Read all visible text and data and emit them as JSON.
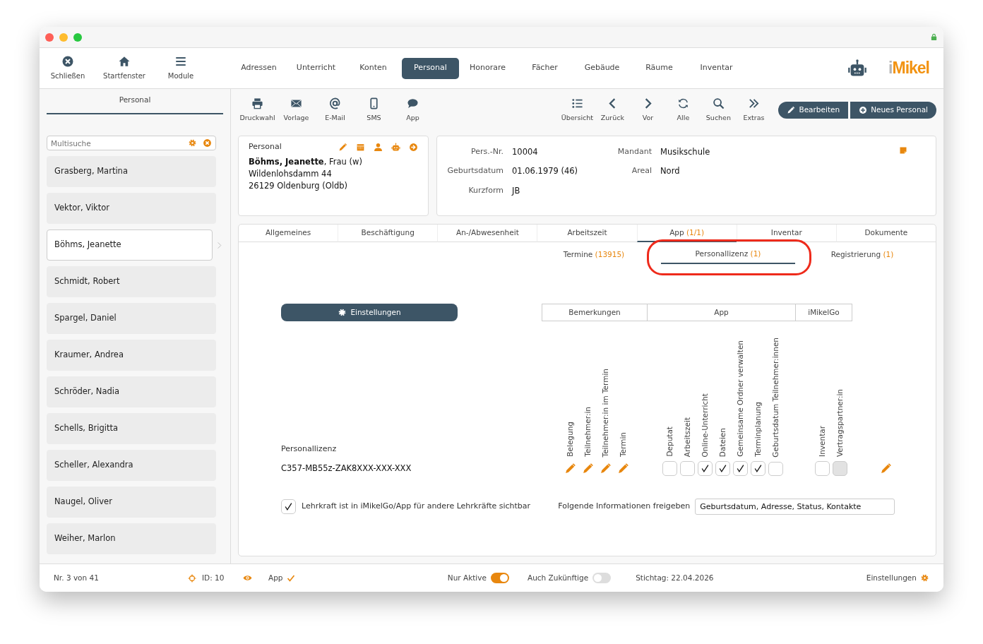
{
  "app_menu": [
    {
      "label": "Schließen"
    },
    {
      "label": "Startfenster"
    },
    {
      "label": "Module"
    }
  ],
  "modules": [
    {
      "label": "Adressen",
      "selected": false
    },
    {
      "label": "Unterricht",
      "selected": false
    },
    {
      "label": "Konten",
      "selected": false
    },
    {
      "label": "Personal",
      "selected": true
    },
    {
      "label": "Honorare",
      "selected": false
    },
    {
      "label": "Fächer",
      "selected": false
    },
    {
      "label": "Gebäude",
      "selected": false
    },
    {
      "label": "Räume",
      "selected": false
    },
    {
      "label": "Inventar",
      "selected": false
    }
  ],
  "logo": "iMikel",
  "sidebar": {
    "title": "Personal",
    "search": {
      "placeholder": "Multisuche"
    },
    "items": [
      {
        "name": "Grasberg, Martina",
        "selected": false
      },
      {
        "name": "Vektor, Viktor",
        "selected": false
      },
      {
        "name": "Böhms, Jeanette",
        "selected": true
      },
      {
        "name": "Schmidt, Robert",
        "selected": false
      },
      {
        "name": "Spargel, Daniel",
        "selected": false
      },
      {
        "name": "Kraumer, Andrea",
        "selected": false
      },
      {
        "name": "Schröder, Nadia",
        "selected": false
      },
      {
        "name": "Schells, Brigitta",
        "selected": false
      },
      {
        "name": "Scheller, Alexandra",
        "selected": false
      },
      {
        "name": "Naugel, Oliver",
        "selected": false
      },
      {
        "name": "Weiher, Marlon",
        "selected": false
      }
    ]
  },
  "toolbar": {
    "left": [
      "Druckwahl",
      "Vorlage",
      "E-Mail",
      "SMS",
      "App"
    ],
    "right": [
      "Übersicht",
      "Zurück",
      "Vor",
      "Alle",
      "Suchen",
      "Extras"
    ],
    "buttons": [
      "Bearbeiten",
      "Neues Personal"
    ]
  },
  "person_card": {
    "title": "Personal",
    "lines": [
      "**Böhms, Jeanette**, Frau (w)",
      "Wildenlohsdamm 44",
      "26129 Oldenburg (Oldb)"
    ]
  },
  "details": {
    "fields": [
      {
        "label": "Pers.-Nr.",
        "value": "10004"
      },
      {
        "label": "Mandant",
        "value": "Musikschule"
      },
      {
        "label": "Geburtsdatum",
        "value": "01.06.1979 (46)"
      },
      {
        "label": "Areal",
        "value": "Nord"
      },
      {
        "label": "Kurzform",
        "value": "JB"
      }
    ]
  },
  "tabs": [
    {
      "label": "Allgemeines",
      "selected": false
    },
    {
      "label": "Beschäftigung",
      "selected": false
    },
    {
      "label": "An-/Abwesenheit",
      "selected": false
    },
    {
      "label": "Arbeitszeit",
      "selected": false
    },
    {
      "label": "App",
      "count": "(1/1)",
      "selected": true
    },
    {
      "label": "Inventar",
      "selected": false
    },
    {
      "label": "Dokumente",
      "selected": false
    }
  ],
  "subtabs": [
    {
      "label": "Termine",
      "count": "(13915)",
      "selected": false
    },
    {
      "label": "Personallizenz",
      "count": "(1)",
      "selected": true
    },
    {
      "label": "Registrierung",
      "count": "(1)",
      "selected": false
    }
  ],
  "settings_button": "Einstellungen",
  "section_header": [
    "Bemerkungen",
    "App",
    "iMikelGo"
  ],
  "license": {
    "label": "Personallizenz",
    "value": "C357-MB55z-ZAK8XXX-XXX-XXX"
  },
  "permissions": [
    {
      "items": [
        {
          "label": "Belegung",
          "kind": "edit"
        },
        {
          "label": "Teilnehmer:in",
          "kind": "edit"
        },
        {
          "label": "Teilnehmer:in im Termin",
          "kind": "edit"
        },
        {
          "label": "Termin",
          "kind": "edit"
        }
      ]
    },
    {
      "items": [
        {
          "label": "Deputat",
          "kind": "checkbox",
          "checked": false,
          "disabled": false
        },
        {
          "label": "Arbeitszeit",
          "kind": "checkbox",
          "checked": false,
          "disabled": false
        },
        {
          "label": "Online-Unterricht",
          "kind": "checkbox",
          "checked": true,
          "disabled": false
        },
        {
          "label": "Dateien",
          "kind": "checkbox",
          "checked": true,
          "disabled": false
        },
        {
          "label": "Gemeinsame Ordner verwalten",
          "kind": "checkbox",
          "checked": true,
          "disabled": false
        },
        {
          "label": "Terminplanung",
          "kind": "checkbox",
          "checked": true,
          "disabled": false
        },
        {
          "label": "Geburtsdatum Teilnehmer:innen",
          "kind": "checkbox",
          "checked": false,
          "disabled": false
        }
      ]
    },
    {
      "items": [
        {
          "label": "Inventar",
          "kind": "checkbox",
          "checked": false,
          "disabled": false
        },
        {
          "label": "Vertragspartner:in",
          "kind": "checkbox",
          "checked": false,
          "disabled": true
        }
      ]
    },
    {
      "items": [
        {
          "kind": "edit"
        }
      ]
    }
  ],
  "visibility": {
    "label": "Lehrkraft ist in iMikelGo/App für andere Lehrkräfte sichtbar",
    "checked": true
  },
  "share": {
    "label": "Folgende Informationen freigeben",
    "value": "Geburtsdatum, Adresse, Status, Kontakte"
  },
  "status_bar": {
    "record": "Nr. 3 von 41",
    "id": "ID: 10",
    "app": "App",
    "toggles": [
      {
        "label": "Nur Aktive",
        "on": true
      },
      {
        "label": "Auch Zukünftige",
        "on": false
      }
    ],
    "date": "Stichtag: 22.04.2026",
    "settings": "Einstellungen"
  }
}
